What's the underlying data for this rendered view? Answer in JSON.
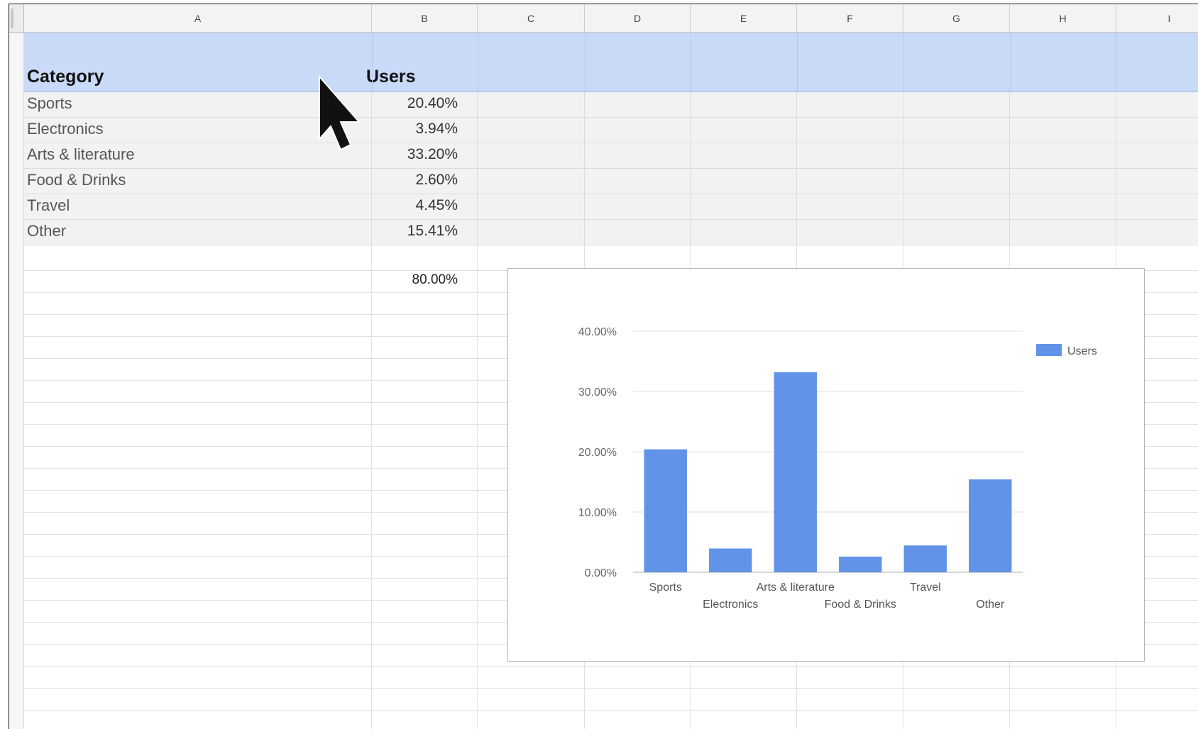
{
  "columns": [
    "A",
    "B",
    "C",
    "D",
    "E",
    "F",
    "G",
    "H",
    "I"
  ],
  "header_row": {
    "category_label": "Category",
    "users_label": "Users"
  },
  "rows": [
    {
      "category": "Sports",
      "users": "20.40%"
    },
    {
      "category": "Electronics",
      "users": "3.94%"
    },
    {
      "category": "Arts & literature",
      "users": "33.20%"
    },
    {
      "category": "Food & Drinks",
      "users": "2.60%"
    },
    {
      "category": "Travel",
      "users": "4.45%"
    },
    {
      "category": "Other",
      "users": "15.41%"
    }
  ],
  "total": {
    "users": "80.00%"
  },
  "chart_data": {
    "type": "bar",
    "categories": [
      "Sports",
      "Electronics",
      "Arts & literature",
      "Food & Drinks",
      "Travel",
      "Other"
    ],
    "series": [
      {
        "name": "Users",
        "values": [
          20.4,
          3.94,
          33.2,
          2.6,
          4.45,
          15.41
        ],
        "color": "#6193e8"
      }
    ],
    "yticks": [
      "0.00%",
      "10.00%",
      "20.00%",
      "30.00%",
      "40.00%"
    ],
    "ylim": [
      0,
      40
    ],
    "grid": true,
    "legend_position": "right",
    "title": "",
    "xlabel": "",
    "ylabel": ""
  },
  "colors": {
    "header_band": "#c9daf8",
    "bar": "#6193e8",
    "row_alt": "#f2f2f2"
  }
}
